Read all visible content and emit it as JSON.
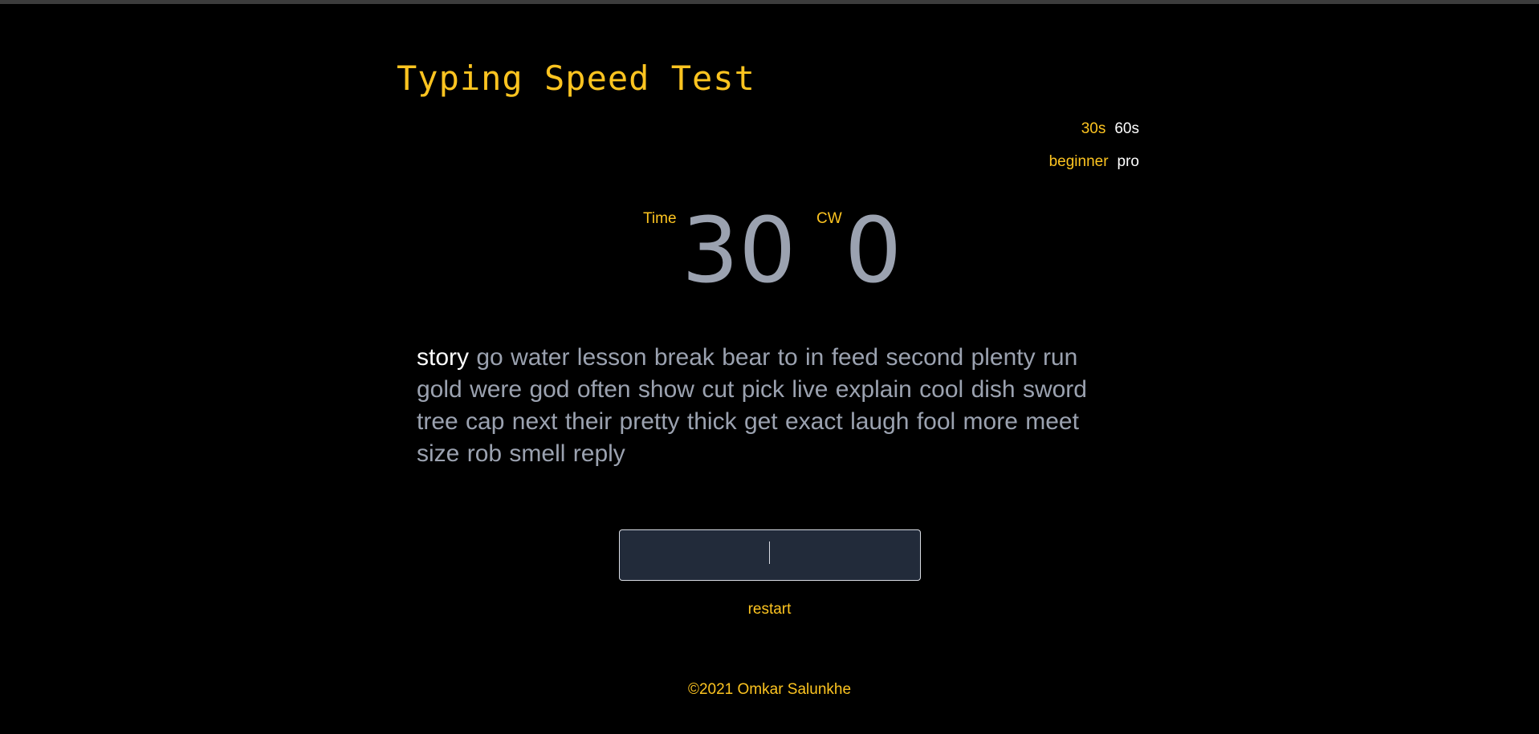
{
  "app": {
    "title": "Typing Speed Test"
  },
  "options": {
    "durations": [
      {
        "label": "30s",
        "selected": true
      },
      {
        "label": "60s",
        "selected": false
      }
    ],
    "levels": [
      {
        "label": "beginner",
        "selected": true
      },
      {
        "label": "pro",
        "selected": false
      }
    ]
  },
  "stats": {
    "time_label": "Time",
    "time_value": "30",
    "cw_label": "CW",
    "cw_value": "0"
  },
  "words": [
    "story",
    "go",
    "water",
    "lesson",
    "break",
    "bear",
    "to",
    "in",
    "feed",
    "second",
    "plenty",
    "run",
    "gold",
    "were",
    "god",
    "often",
    "show",
    "cut",
    "pick",
    "live",
    "explain",
    "cool",
    "dish",
    "sword",
    "tree",
    "cap",
    "next",
    "their",
    "pretty",
    "thick",
    "get",
    "exact",
    "laugh",
    "fool",
    "more",
    "meet",
    "size",
    "rob",
    "smell",
    "reply"
  ],
  "current_word_index": 0,
  "input": {
    "value": "",
    "placeholder": ""
  },
  "restart_label": "restart",
  "footer": {
    "text": "©2021 Omkar Salunkhe"
  },
  "colors": {
    "accent": "#fdc420",
    "background": "#000000",
    "muted_text": "#9ba2b0",
    "input_bg": "#222b3a"
  }
}
